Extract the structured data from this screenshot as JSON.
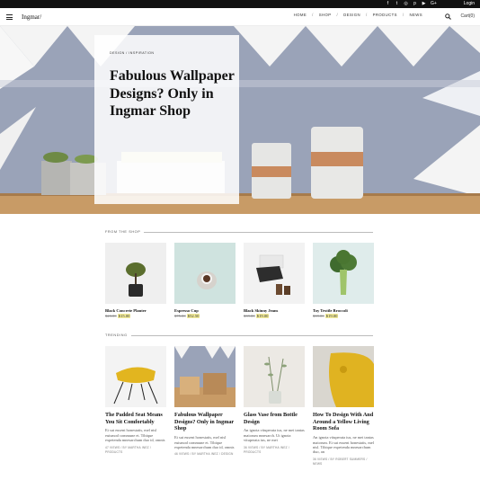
{
  "topbar": {
    "social": [
      {
        "icon": "facebook-icon",
        "glyph": "f"
      },
      {
        "icon": "twitter-icon",
        "glyph": "t"
      },
      {
        "icon": "instagram-icon",
        "glyph": "◎"
      },
      {
        "icon": "pinterest-icon",
        "glyph": "p"
      },
      {
        "icon": "youtube-icon",
        "glyph": "▶"
      },
      {
        "icon": "google-plus-icon",
        "glyph": "G+"
      }
    ],
    "login_label": "Login"
  },
  "header": {
    "logo": "Ingmar/",
    "nav": [
      "HOME",
      "SHOP",
      "DESIGN",
      "PRODUCTS",
      "NEWS"
    ],
    "cart_label": "Cart(0)"
  },
  "hero": {
    "category": "DESIGN / INSPIRATION",
    "title": "Fabulous Wallpaper Designs? Only in Ingmar Shop"
  },
  "shop": {
    "label": "FROM THE SHOP",
    "products": [
      {
        "name": "Black Concrete Planter",
        "old_price": "$23.00",
        "new_price": "$15.00"
      },
      {
        "name": "Espresso Cup",
        "old_price": "$75.00",
        "new_price": "$52.50"
      },
      {
        "name": "Black Skinny Jeans",
        "old_price": "$39.00",
        "new_price": "$19.00"
      },
      {
        "name": "Toy Textile Broccoli",
        "old_price": "$39.00",
        "new_price": "$19.00"
      }
    ]
  },
  "trending": {
    "label": "TRENDING",
    "posts": [
      {
        "title": "The Padded Seat Means You Sit Comfortably",
        "excerpt": "Et sut eusent honestatis, mel nisl euismod commune et. Tibique expetenda mnesarchum duo id, omnis",
        "meta": "47 VIEWS / BY MARTHA INEZ / PRODUCTS"
      },
      {
        "title": "Fabulous Wallpaper Designs? Only in Ingmar Shop",
        "excerpt": "Et sut eusent honestatis, mel nisl euismod commune et. Tibique expetenda mnesarchum duo id, omnis",
        "meta": "46 VIEWS / BY MARTHA INEZ / DESIGN"
      },
      {
        "title": "Glass Vase from Bottle Design",
        "excerpt": "An ignota vituperata ius, ne mei tantas maiorum mnesarch. Ut ignota vituperata ius, ne mei",
        "meta": "36 VIEWS / BY MARTHA INEZ / PRODUCTS"
      },
      {
        "title": "How To Design With And Around a Yellow Living Room Sofa",
        "excerpt": "An ignota vituperata ius, ne mei tantas maiorum. Et sut eusent honestatis, mel nisl. Tibique expetenda mnesarchum duo, an",
        "meta": "36 VIEWS / BY ROBERT SUMMERS / NEWS"
      }
    ]
  },
  "colors": {
    "accent_highlight": "#f3ec9a",
    "topbar": "#111111",
    "hero_wall": "#9aa3b8"
  }
}
